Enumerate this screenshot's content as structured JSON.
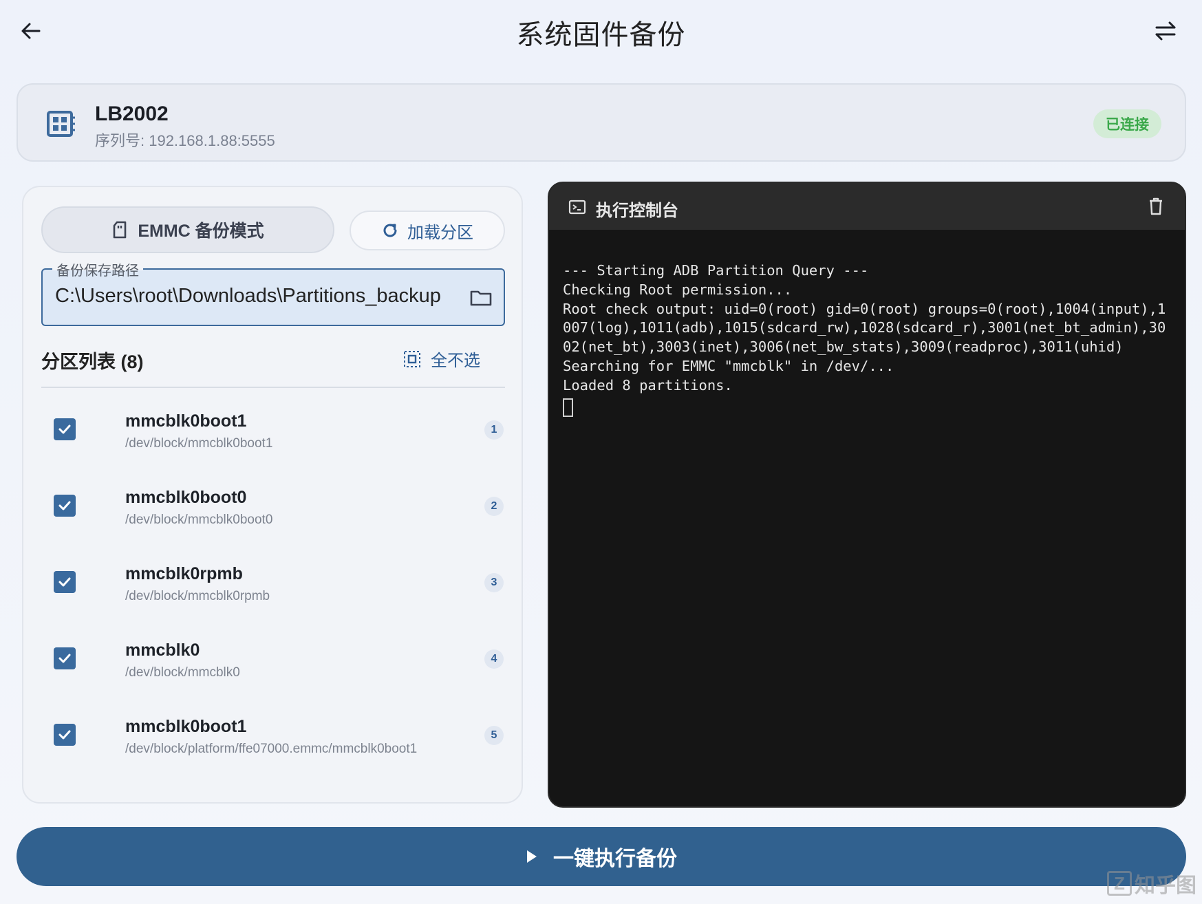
{
  "header": {
    "title": "系统固件备份"
  },
  "device": {
    "name": "LB2002",
    "serial": "序列号: 192.168.1.88:5555",
    "status": "已连接"
  },
  "left_panel": {
    "mode_label": "EMMC 备份模式",
    "load_label": "加载分区",
    "path_legend": "备份保存路径",
    "path_value": "C:\\Users\\root\\Downloads\\Partitions_backup",
    "list_title": "分区列表 (8)",
    "deselect_label": "全不选",
    "partitions": [
      {
        "name": "mmcblk0boot1",
        "path": "/dev/block/mmcblk0boot1",
        "index": "1",
        "checked": true
      },
      {
        "name": "mmcblk0boot0",
        "path": "/dev/block/mmcblk0boot0",
        "index": "2",
        "checked": true
      },
      {
        "name": "mmcblk0rpmb",
        "path": "/dev/block/mmcblk0rpmb",
        "index": "3",
        "checked": true
      },
      {
        "name": "mmcblk0",
        "path": "/dev/block/mmcblk0",
        "index": "4",
        "checked": true
      },
      {
        "name": "mmcblk0boot1",
        "path": "/dev/block/platform/ffe07000.emmc/mmcblk0boot1",
        "index": "5",
        "checked": true
      }
    ]
  },
  "console": {
    "title": "执行控制台",
    "lines": [
      "--- Starting ADB Partition Query ---",
      "Checking Root permission...",
      "Root check output: uid=0(root) gid=0(root) groups=0(root),1004(input),1",
      "007(log),1011(adb),1015(sdcard_rw),1028(sdcard_r),3001(net_bt_admin),30",
      "02(net_bt),3003(inet),3006(net_bw_stats),3009(readproc),3011(uhid)",
      "Searching for EMMC \"mmcblk\" in /dev/...",
      "Loaded 8 partitions."
    ]
  },
  "action": {
    "execute_label": "一键执行备份"
  },
  "watermark": {
    "text": "知乎图",
    "mark": "Z"
  },
  "colors": {
    "primary": "#31618f",
    "connected": "#3aa84a",
    "console_bg": "#151515"
  },
  "icons": {
    "back": "arrow-left-icon",
    "swap": "swap-icon",
    "device": "chip-icon",
    "mode": "sd-card-icon",
    "load": "refresh-icon",
    "folder": "folder-icon",
    "deselect": "select-all-icon",
    "console": "terminal-icon",
    "trash": "trash-icon",
    "play": "play-icon",
    "checkbox": "checkbox-checked-icon"
  }
}
